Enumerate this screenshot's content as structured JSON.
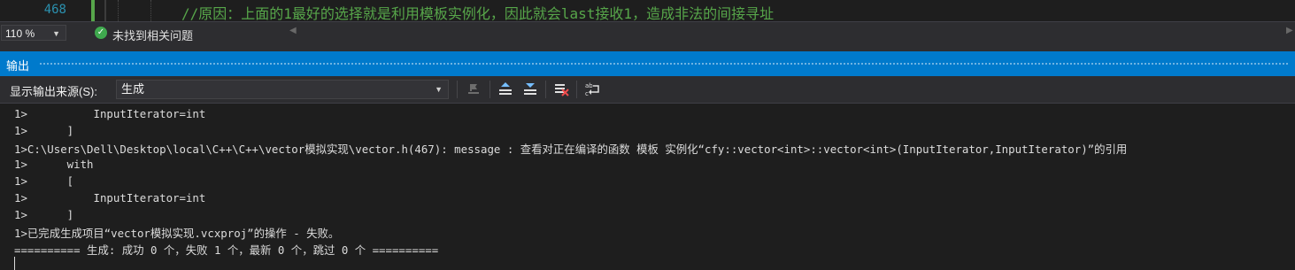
{
  "editor": {
    "line_number": "468",
    "comment": "//原因：上面的1最好的选择就是利用模板实例化，因此就会last接收1，造成非法的间接寻址"
  },
  "status_bar": {
    "zoom": "110 %",
    "issues_text": "未找到相关问题",
    "ok_icon": "check-circle-icon"
  },
  "output_panel": {
    "title": "输出",
    "source_label": "显示输出来源(S):",
    "source_value": "生成",
    "toolbar_icons": [
      "go-to-error-icon",
      "previous-message-icon",
      "next-message-icon",
      "clear-all-icon",
      "toggle-word-wrap-icon"
    ],
    "lines": [
      "1>          InputIterator=int",
      "1>      ]",
      "1>C:\\Users\\Dell\\Desktop\\local\\C++\\C++\\vector模拟实现\\vector.h(467): message : 查看对正在编译的函数 模板 实例化“cfy::vector<int>::vector<int>(InputIterator,InputIterator)”的引用",
      "1>      with",
      "1>      [",
      "1>          InputIterator=int",
      "1>      ]",
      "1>已完成生成项目“vector模拟实现.vcxproj”的操作 - 失败。",
      "========== 生成: 成功 0 个，失败 1 个，最新 0 个，跳过 0 个 =========="
    ]
  },
  "colors": {
    "accent": "#007acc",
    "comment": "#57a64a",
    "line_number": "#2b91af",
    "background": "#1e1e1e"
  }
}
